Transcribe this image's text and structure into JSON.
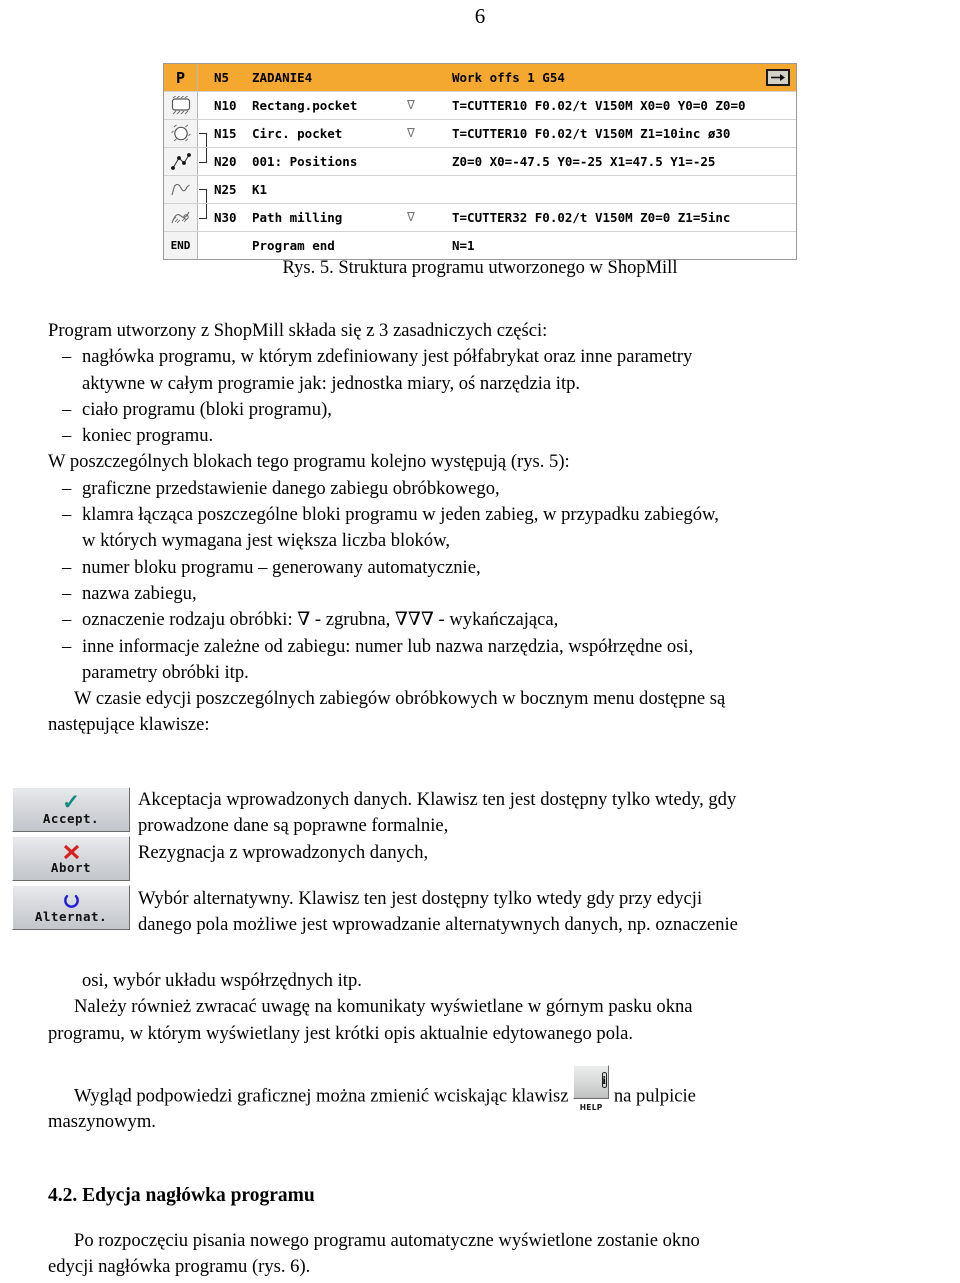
{
  "page": {
    "number": "6"
  },
  "figure": {
    "caption": "Rys. 5. Struktura programu utworzonego w ShopMill",
    "accent_color": "#f5a830",
    "rows": [
      {
        "icon": "program-header-icon",
        "icon_text": "P",
        "number": "N5",
        "name": "ZADANIE4",
        "mark": "",
        "params": "Work offs 1 G54",
        "selected": true,
        "has_arrow_button": true
      },
      {
        "icon": "rectangular-pocket-icon",
        "icon_text": "",
        "number": "N10",
        "name": "Rectang.pocket",
        "mark": "∇",
        "params": "T=CUTTER10 F0.02/t V150M X0=0 Y0=0 Z0=0",
        "selected": false,
        "has_arrow_button": false
      },
      {
        "icon": "circular-pocket-icon",
        "icon_text": "",
        "number": "N15",
        "name": "Circ. pocket",
        "mark": "∇",
        "params": "T=CUTTER10 F0.02/t V150M Z1=10inc ø30",
        "selected": false,
        "has_arrow_button": false,
        "bracket": "top"
      },
      {
        "icon": "positions-icon",
        "icon_text": "",
        "number": "N20",
        "name": "001: Positions",
        "mark": "",
        "params": "Z0=0 X0=-47.5 Y0=-25 X1=47.5 Y1=-25",
        "selected": false,
        "has_arrow_button": false,
        "bracket": "bottom"
      },
      {
        "icon": "contour-icon",
        "icon_text": "",
        "number": "N25",
        "name": "K1",
        "mark": "",
        "params": "",
        "selected": false,
        "has_arrow_button": false,
        "bracket": "top"
      },
      {
        "icon": "path-milling-icon",
        "icon_text": "",
        "number": "N30",
        "name": "Path milling",
        "mark": "∇",
        "params": "T=CUTTER32 F0.02/t V150M Z0=0 Z1=5inc",
        "selected": false,
        "has_arrow_button": false,
        "bracket": "bottom"
      },
      {
        "icon": "program-end-icon",
        "icon_text": "END",
        "number": "",
        "name": "Program end",
        "mark": "",
        "params": "N=1",
        "selected": false,
        "has_arrow_button": false
      }
    ]
  },
  "body": {
    "intro": "Program utworzony z ShopMill składa się z 3 zasadniczych części:",
    "parts": [
      {
        "line1": "nagłówka programu, w którym zdefiniowany jest półfabrykat oraz inne parametry",
        "line2": "aktywne w całym programie jak: jednostka miary, oś narzędzia itp."
      },
      {
        "line1": "ciało programu (bloki programu),",
        "line2": ""
      },
      {
        "line1": "koniec programu.",
        "line2": ""
      }
    ],
    "blocks_intro": "W poszczególnych blokach tego programu kolejno występują (rys. 5):",
    "block_items": [
      {
        "line1": "graficzne przedstawienie danego zabiegu obróbkowego,",
        "line2": ""
      },
      {
        "line1": "klamra łącząca poszczególne bloki programu w jeden zabieg, w przypadku zabiegów,",
        "line2": "w których wymagana jest większa liczba bloków,"
      },
      {
        "line1": "numer bloku programu – generowany automatycznie,",
        "line2": ""
      },
      {
        "line1": "nazwa zabiegu,",
        "line2": ""
      },
      {
        "line1": "oznaczenie rodzaju obróbki: ∇ - zgrubna, ∇∇∇ - wykańczająca,",
        "line2": ""
      },
      {
        "line1": "inne informacje zależne od zabiegu: numer lub nazwa narzędzia, współrzędne osi,",
        "line2": "parametry obróbki itp."
      }
    ],
    "keys_intro_line1": "W czasie edycji poszczególnych zabiegów obróbkowych w bocznym menu dostępne są",
    "keys_intro_line2": "następujące klawisze:"
  },
  "softkeys": [
    {
      "label": "Accept.",
      "icon": "check-icon",
      "icon_glyph": "✓",
      "icon_color": "#118a80",
      "description_line1": "Akceptacja wprowadzonych danych. Klawisz ten jest dostępny tylko wtedy, gdy",
      "description_line2": "prowadzone dane są poprawne formalnie,"
    },
    {
      "label": "Abort",
      "icon": "cross-icon",
      "icon_glyph": "✖",
      "icon_color": "#d81f1f",
      "description_line1": "Rezygnacja z wprowadzonych danych,",
      "description_line2": ""
    },
    {
      "label": "Alternat.",
      "icon": "circular-arrow-icon",
      "icon_glyph": "↻",
      "icon_color": "#1f1fd8",
      "description_line1": "Wybór alternatywny. Klawisz ten jest dostępny tylko wtedy gdy przy edycji",
      "description_line2": "danego pola możliwe jest wprowadzanie alternatywnych danych, np. oznaczenie",
      "description_line3": "osi, wybór układu współrzędnych itp."
    }
  ],
  "tail": {
    "note_line1": "Należy również zwracać uwagę na komunikaty wyświetlane w górnym pasku okna",
    "note_line2": "programu, w którym wyświetlany jest krótki opis aktualnie edytowanego pola.",
    "help_line_before": "Wygląd podpowiedzi graficznej można zmienić wciskając klawisz",
    "help_key": {
      "icon": "info-icon",
      "glyph": "i",
      "label": "HELP"
    },
    "help_line_after": "na pulpicie",
    "help_line2": "maszynowym."
  },
  "section": {
    "heading": "4.2. Edycja nagłówka programu",
    "paragraph_line1": "Po rozpoczęciu   pisania nowego programu automatyczne wyświetlone zostanie okno",
    "paragraph_line2": "edycji nagłówka programu (rys. 6)."
  }
}
